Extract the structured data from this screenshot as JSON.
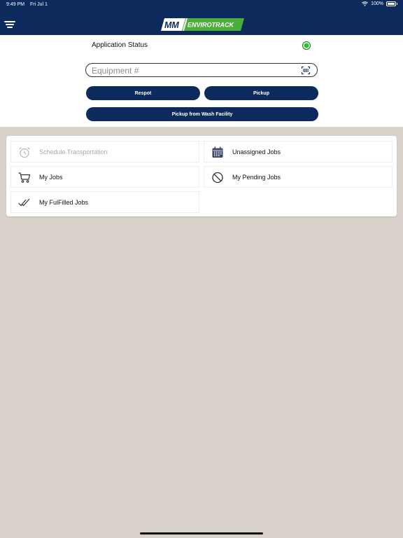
{
  "status_bar": {
    "time": "9:49 PM",
    "date": "Fri Jul 1",
    "battery": "100%"
  },
  "header": {
    "logo_text": "ENVIROTRACK",
    "logo_mark": "MM",
    "menu_icon": "filter-menu-icon"
  },
  "app_status": {
    "label": "Application Status",
    "indicator_color": "#2dc02d"
  },
  "equipment": {
    "placeholder": "Equipment #",
    "value": "",
    "scan_icon": "barcode-scan-icon"
  },
  "actions": {
    "respot": "Respot",
    "pickup": "Pickup",
    "wash": "Pickup from Wash Facility"
  },
  "menu": {
    "schedule": {
      "label": "Schedule Transportation",
      "icon": "alarm-clock-icon"
    },
    "unassigned": {
      "label": "Unassigned Jobs",
      "icon": "calendar-icon"
    },
    "my_jobs": {
      "label": "My Jobs",
      "icon": "cart-icon"
    },
    "pending": {
      "label": "My Pending Jobs",
      "icon": "blocked-icon"
    },
    "fulfilled": {
      "label": "My FulFilled Jobs",
      "icon": "double-check-icon"
    }
  },
  "colors": {
    "brand_navy": "#0d2a5c",
    "logo_green": "#4cae3a",
    "background": "#d8d2cb"
  }
}
